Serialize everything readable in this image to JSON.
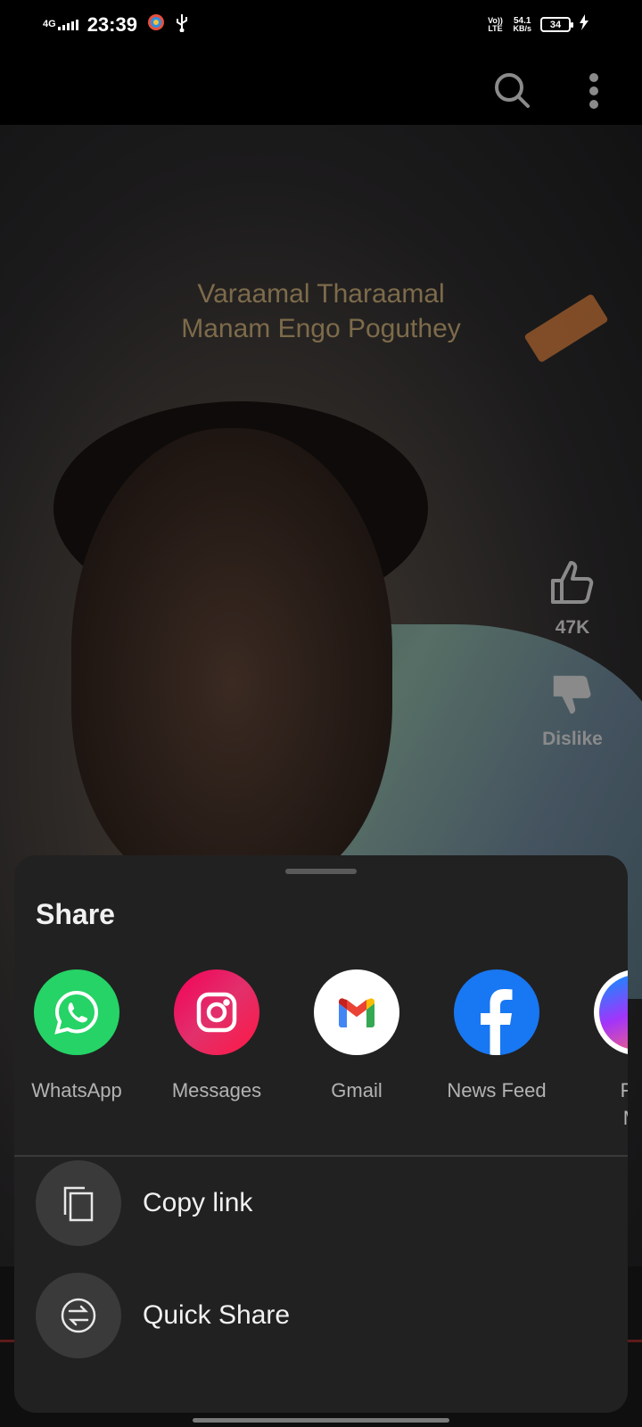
{
  "status_bar": {
    "network": "4G",
    "time": "23:39",
    "volte": "Vo)) LTE",
    "speed_value": "54.1",
    "speed_unit": "KB/s",
    "battery": "34"
  },
  "video": {
    "lyrics_line1": "Varaamal Tharaamal",
    "lyrics_line2": "Manam Engo Poguthey",
    "like_count": "47K",
    "dislike_label": "Dislike"
  },
  "share_sheet": {
    "title": "Share",
    "apps": [
      {
        "label": "WhatsApp",
        "icon": "whatsapp-icon",
        "color": "#25D366"
      },
      {
        "label": "Messages",
        "icon": "instagram-icon",
        "color": "#E1306C"
      },
      {
        "label": "Gmail",
        "icon": "gmail-icon",
        "color": "#FFFFFF"
      },
      {
        "label": "News Feed",
        "icon": "facebook-icon",
        "color": "#1877F2"
      },
      {
        "label": "Fac\nMe",
        "icon": "messenger-icon",
        "color": "#A334FA"
      }
    ],
    "actions": [
      {
        "label": "Copy link",
        "icon": "copy-icon"
      },
      {
        "label": "Quick Share",
        "icon": "quick-share-icon"
      }
    ]
  },
  "colors": {
    "sheet_background": "#212121",
    "action_icon_background": "#3a3a3a"
  }
}
